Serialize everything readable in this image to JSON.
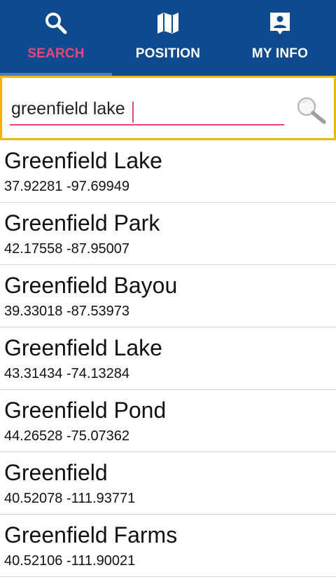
{
  "tabs": [
    {
      "label": "SEARCH",
      "icon": "search-icon",
      "active": true
    },
    {
      "label": "POSITION",
      "icon": "map-icon",
      "active": false
    },
    {
      "label": "MY INFO",
      "icon": "contact-card-icon",
      "active": false
    }
  ],
  "colors": {
    "header_bg": "#0d4a8e",
    "active_tab": "#e8467c",
    "tab_indicator": "#4e7cc4",
    "search_border": "#f4b400",
    "input_underline": "#e8467c"
  },
  "search": {
    "value": "greenfield lake",
    "button_icon": "magnifier-icon"
  },
  "results": [
    {
      "name": "Greenfield Lake",
      "coords": "37.92281 -97.69949"
    },
    {
      "name": "Greenfield Park",
      "coords": "42.17558 -87.95007"
    },
    {
      "name": "Greenfield Bayou",
      "coords": "39.33018 -87.53973"
    },
    {
      "name": "Greenfield Lake",
      "coords": "43.31434 -74.13284"
    },
    {
      "name": "Greenfield Pond",
      "coords": "44.26528 -75.07362"
    },
    {
      "name": "Greenfield",
      "coords": "40.52078 -111.93771"
    },
    {
      "name": "Greenfield Farms",
      "coords": "40.52106 -111.90021"
    }
  ]
}
